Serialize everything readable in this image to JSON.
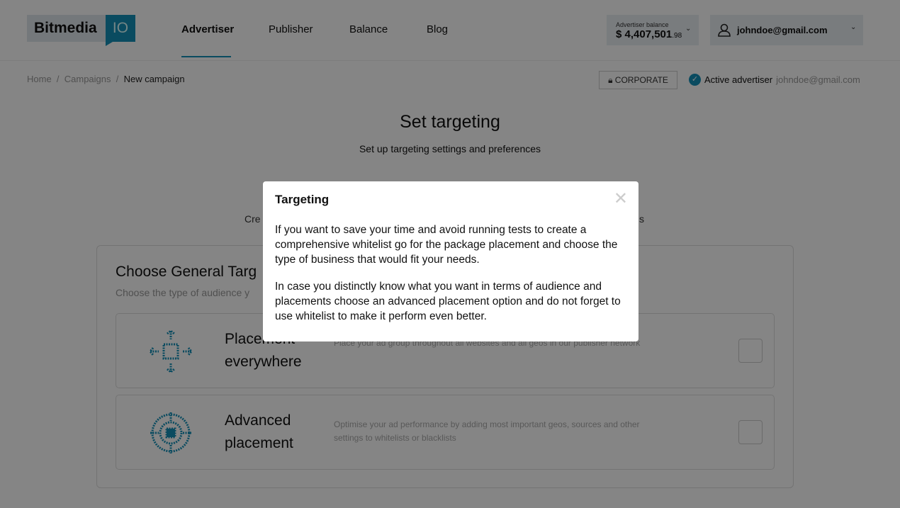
{
  "header": {
    "logo": {
      "name": "Bitmedia",
      "suffix": "IO"
    },
    "nav": [
      {
        "label": "Advertiser",
        "active": true
      },
      {
        "label": "Publisher"
      },
      {
        "label": "Balance"
      },
      {
        "label": "Blog"
      }
    ],
    "balance": {
      "label": "Advertiser balance",
      "amount": "$ 4,407,501",
      "cents": ".98"
    },
    "user": {
      "email": "johndoe@gmail.com"
    }
  },
  "breadcrumb": [
    "Home",
    "Campaigns",
    "New campaign"
  ],
  "account": {
    "type_label": "CORPORATE",
    "status": "Active advertiser",
    "email": "johndoe@gmail.com"
  },
  "page": {
    "title": "Set targeting",
    "subtitle": "Set up targeting settings and preferences",
    "step_fragments": [
      "Cre",
      "s"
    ]
  },
  "panel": {
    "title": "Choose General Targ",
    "subtitle": "Choose the type of audience y",
    "options": [
      {
        "title": "Placement everywhere",
        "description": "Place your ad group throughout all websites and all geos in our publisher network",
        "icon": "arrows-icon",
        "checked": false
      },
      {
        "title": "Advanced placement",
        "description": "Optimise your ad performance by adding most important geos, sources and other settings to whitelists or blacklists",
        "icon": "target-icon",
        "checked": false
      }
    ]
  },
  "modal": {
    "title": "Targeting",
    "paragraphs": [
      "If you want to save your time and avoid running tests to create a comprehensive whitelist go for the package placement and choose the type of business that would fit your needs.",
      "In case you distinctly know what you want in terms of audience and placements choose an advanced placement option and do not forget to use whitelist to make it perform even better."
    ]
  },
  "colors": {
    "accent": "#1590b8"
  }
}
